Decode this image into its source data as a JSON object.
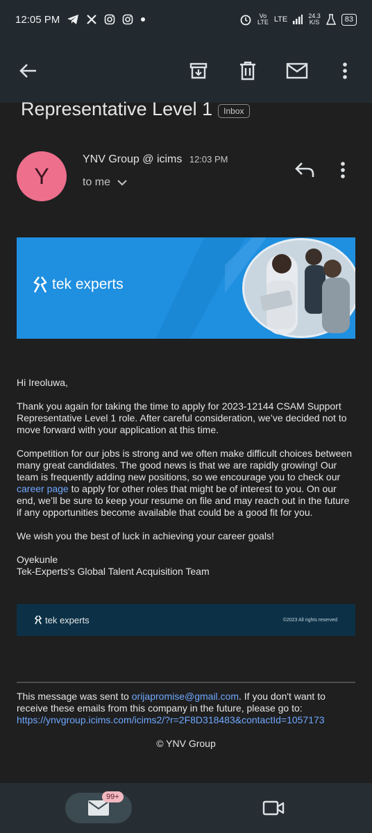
{
  "status_bar": {
    "time": "12:05 PM",
    "network_vo": "Vo",
    "network_lte_small": "LTE",
    "lte": "LTE",
    "speed_value": "24.3",
    "speed_unit": "K/S",
    "battery": "83",
    "notification_icons": [
      "telegram-icon",
      "x-icon",
      "instagram-icon",
      "instagram-icon"
    ]
  },
  "app_bar": {
    "icons": [
      "back-arrow-icon",
      "archive-icon",
      "delete-icon",
      "mail-icon",
      "more-vert-icon"
    ]
  },
  "email": {
    "subject": "Representative Level 1",
    "label": "Inbox",
    "avatar_letter": "Y",
    "sender": "YNV Group @ icims",
    "time": "12:03 PM",
    "to": "to me"
  },
  "banner": {
    "brand": "tek experts"
  },
  "body": {
    "greeting": "Hi Ireoluwa,",
    "p1": "Thank you again for taking the time to apply for 2023-12144 CSAM Support Representative Level 1 role. After careful consideration, we’ve decided not to move forward with your application at this time.",
    "p2_before": "Competition for our jobs is strong and we often make difficult choices between many great candidates. The good news is that we are rapidly growing! Our team is frequently adding new positions, so we encourage you to check our ",
    "p2_link": "career page",
    "p2_after": " to apply for other roles that might be of interest to you. On our end, we’ll be sure to keep your resume on file and may reach out in the future if any opportunities become available that could be a good fit for you.",
    "p3": "We wish you the best of luck in achieving your career goals!",
    "sign_name": "Oyekunle",
    "sign_team": "Tek-Experts's Global Talent Acquisition Team"
  },
  "footer_banner": {
    "brand": "tek experts",
    "copyright": "©2023 All rights reserved"
  },
  "unsubscribe": {
    "before": "This message was sent to ",
    "email": "orijapromise@gmail.com",
    "middle": ". If you don't want to receive these emails from this company in the future, please go to: ",
    "url": "https://ynvgroup.icims.com/icims2/?r=2F8D318483&contactId=1057173"
  },
  "copyright": "© YNV Group",
  "bottom_nav": {
    "mail_badge": "99+"
  }
}
